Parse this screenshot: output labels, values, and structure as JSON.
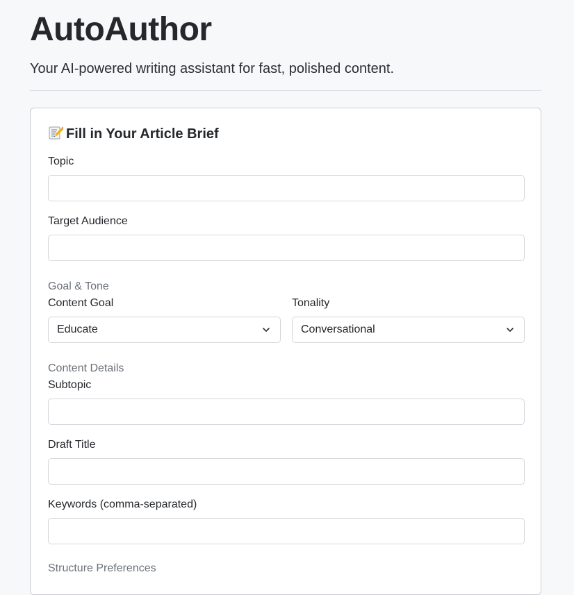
{
  "app": {
    "title": "AutoAuthor",
    "subtitle": "Your AI-powered writing assistant for fast, polished content."
  },
  "form": {
    "title_emoji": "📝",
    "title": "Fill in Your Article Brief",
    "topic": {
      "label": "Topic",
      "value": ""
    },
    "audience": {
      "label": "Target Audience",
      "value": ""
    },
    "goal_tone_section": "Goal & Tone",
    "content_goal": {
      "label": "Content Goal",
      "value": "Educate"
    },
    "tonality": {
      "label": "Tonality",
      "value": "Conversational"
    },
    "details_section": "Content Details",
    "subtopic": {
      "label": "Subtopic",
      "value": ""
    },
    "draft_title": {
      "label": "Draft Title",
      "value": ""
    },
    "keywords": {
      "label": "Keywords (comma-separated)",
      "value": ""
    },
    "structure_section": "Structure Preferences"
  },
  "icons": {
    "title_icon": "memo-icon",
    "dropdown_icon": "chevron-down-icon"
  },
  "colors": {
    "page_bg": "#f7f8fa",
    "card_bg": "#ffffff",
    "section_label": "#6b7178"
  }
}
